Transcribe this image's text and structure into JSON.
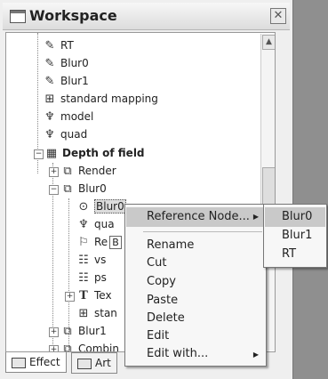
{
  "window": {
    "title": "Workspace",
    "close_label": "✕"
  },
  "tree": {
    "items": [
      {
        "label": "RT",
        "icon": "pencil-icon",
        "glyph": "✎"
      },
      {
        "label": "Blur0",
        "icon": "pencil-icon",
        "glyph": "✎"
      },
      {
        "label": "Blur1",
        "icon": "pencil-icon",
        "glyph": "✎"
      },
      {
        "label": "standard mapping",
        "icon": "mapping-icon",
        "glyph": "⊞"
      },
      {
        "label": "model",
        "icon": "model-icon",
        "glyph": "♆"
      },
      {
        "label": "quad",
        "icon": "model-icon",
        "glyph": "♆"
      },
      {
        "label": "Depth of field",
        "icon": "effect-icon",
        "glyph": "▦"
      },
      {
        "label": "Render",
        "icon": "pass-icon",
        "glyph": "⧉"
      },
      {
        "label": "Blur0",
        "icon": "pass-icon",
        "glyph": "⧉"
      },
      {
        "label": "Blur0",
        "icon": "reference-node-icon",
        "glyph": "⊙"
      },
      {
        "label": "qua",
        "icon": "model-icon",
        "glyph": "♆"
      },
      {
        "label": "Re",
        "icon": "flag-icon",
        "glyph": "⚐"
      },
      {
        "label": "vs",
        "icon": "shader-icon",
        "glyph": "☷"
      },
      {
        "label": "ps",
        "icon": "shader-icon",
        "glyph": "☷"
      },
      {
        "label": "Tex",
        "icon": "texture-icon",
        "glyph": "T"
      },
      {
        "label": "stan",
        "icon": "mapping-icon",
        "glyph": "⊞"
      },
      {
        "label": "Blur1",
        "icon": "pass-icon",
        "glyph": "⧉"
      },
      {
        "label": "Combin",
        "icon": "pass-icon",
        "glyph": "⧉"
      }
    ],
    "tooltip_fragment": "B"
  },
  "tabs": [
    {
      "label": "Effect",
      "icon": "effect-tab-icon"
    },
    {
      "label": "Art",
      "icon": "art-tab-icon"
    }
  ],
  "context_menu": {
    "items": [
      {
        "label": "Reference Node...",
        "has_submenu": true
      },
      {
        "label": "Rename"
      },
      {
        "label": "Cut"
      },
      {
        "label": "Copy"
      },
      {
        "label": "Paste"
      },
      {
        "label": "Delete"
      },
      {
        "label": "Edit"
      },
      {
        "label": "Edit with...",
        "has_submenu": true
      }
    ],
    "submenu": {
      "items": [
        "Blur0",
        "Blur1",
        "RT"
      ]
    },
    "arrow_glyph": "▶"
  }
}
